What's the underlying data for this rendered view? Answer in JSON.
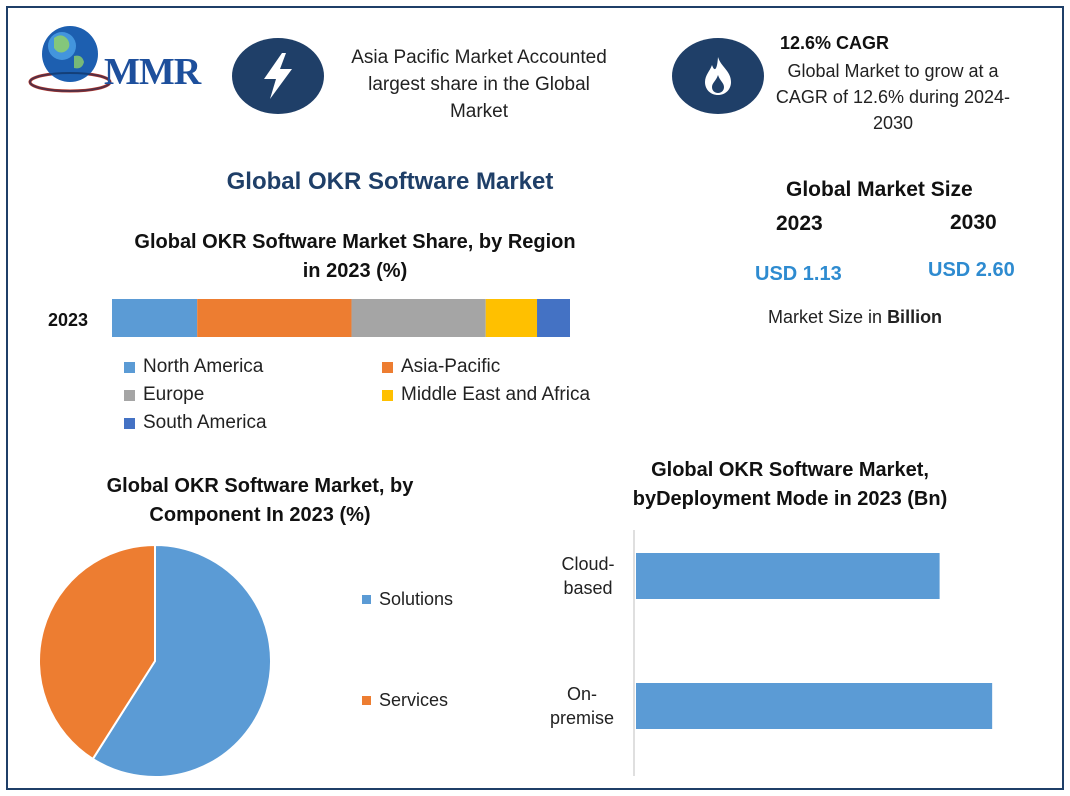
{
  "header": {
    "logo_text": "MMR",
    "highlight_1": {
      "icon": "lightning-icon",
      "line1": "Asia Pacific Market Accounted",
      "line2": "largest share in the Global",
      "line3": "Market"
    },
    "highlight_2": {
      "icon": "flame-icon",
      "title": "12.6% CAGR",
      "line1": "Global Market to grow at a",
      "line2": "CAGR of 12.6% during 2024-",
      "line3": "2030"
    }
  },
  "main_title": "Global OKR Software Market",
  "market_size": {
    "title": "Global Market Size",
    "year_1": "2023",
    "year_2": "2030",
    "value_1": "USD 1.13",
    "value_2": "USD 2.60",
    "note_prefix": "Market Size in",
    "note_unit": "Billion"
  },
  "colors": {
    "north_america": "#5b9bd5",
    "asia_pacific": "#ed7d31",
    "europe": "#a5a5a5",
    "mea": "#ffc000",
    "south_america": "#4472c4",
    "dark_blue": "#1f3f68"
  },
  "chart_data": [
    {
      "type": "bar",
      "orientation": "horizontal-stacked",
      "title_line1": "Global OKR Software Market Share, by Region",
      "title_line2": "in 2023 (%)",
      "categories": [
        "2023"
      ],
      "xlim": [
        0,
        100
      ],
      "series": [
        {
          "name": "North America",
          "values": [
            18.6
          ],
          "color": "#5b9bd5"
        },
        {
          "name": "Asia-Pacific",
          "values": [
            33.7
          ],
          "color": "#ed7d31"
        },
        {
          "name": "Europe",
          "values": [
            29.3
          ],
          "color": "#a5a5a5"
        },
        {
          "name": "Middle East and Africa",
          "values": [
            11.2
          ],
          "color": "#ffc000"
        },
        {
          "name": "South America",
          "values": [
            7.2
          ],
          "color": "#4472c4"
        }
      ],
      "legend_position": "bottom"
    },
    {
      "type": "pie",
      "title_line1": "Global OKR Software Market, by",
      "title_line2": "Component In 2023 (%)",
      "slices": [
        {
          "name": "Solutions",
          "value": 59,
          "color": "#5b9bd5"
        },
        {
          "name": "Services",
          "value": 41,
          "color": "#ed7d31"
        }
      ],
      "legend_position": "right"
    },
    {
      "type": "bar",
      "orientation": "horizontal",
      "title_line1": "Global OKR Software Market,",
      "title_line2": "byDeployment Mode in 2023 (Bn)",
      "categories": [
        {
          "line1": "Cloud-",
          "line2": "based"
        },
        {
          "line1": "On-",
          "line2": "premise"
        }
      ],
      "values": [
        0.52,
        0.61
      ],
      "xlim": [
        0,
        0.62
      ],
      "color": "#5b9bd5"
    }
  ]
}
